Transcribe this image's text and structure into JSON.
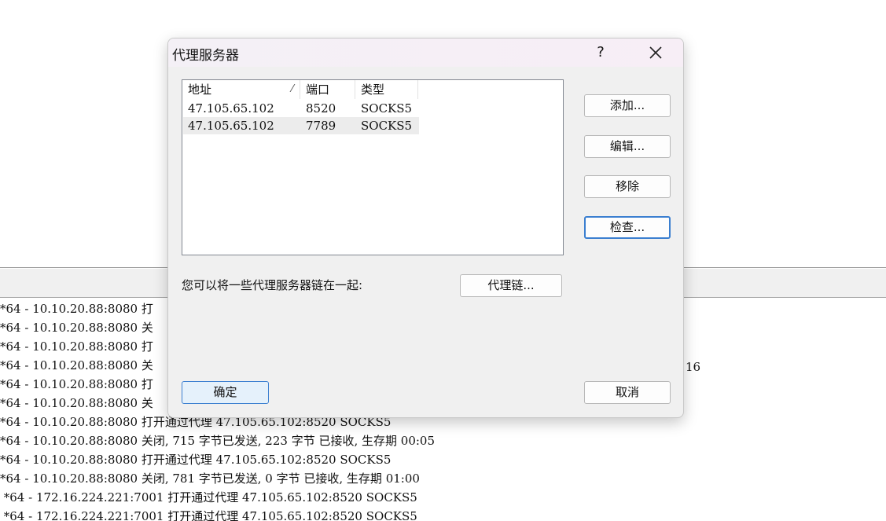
{
  "dialog": {
    "title": "代理服务器",
    "help_label": "?",
    "columns": [
      {
        "label": "地址",
        "sort_indicator": "⁄"
      },
      {
        "label": "端口"
      },
      {
        "label": "类型"
      }
    ],
    "rows": [
      {
        "address": "47.105.65.102",
        "port": "8520",
        "type": "SOCKS5",
        "selected": false
      },
      {
        "address": "47.105.65.102",
        "port": "7789",
        "type": "SOCKS5",
        "selected": true
      }
    ],
    "buttons": {
      "add": "添加...",
      "edit": "编辑...",
      "remove": "移除",
      "check": "检查...",
      "ok": "确定",
      "cancel": "取消",
      "chain": "代理链..."
    },
    "chain_text": "您可以将一些代理服务器链在一起:"
  },
  "log_lines": [
    "*64 - 10.10.20.88:8080 打",
    "*64 - 10.10.20.88:8080 关",
    "*64 - 10.10.20.88:8080 打",
    "*64 - 10.10.20.88:8080 关",
    "*64 - 10.10.20.88:8080 打",
    "*64 - 10.10.20.88:8080 关",
    "*64 - 10.10.20.88:8080 打开通过代理 47.105.65.102:8520 SOCKS5",
    "*64 - 10.10.20.88:8080 关闭, 715 字节已发送, 223 字节 已接收, 生存期 00:05",
    "*64 - 10.10.20.88:8080 打开通过代理 47.105.65.102:8520 SOCKS5",
    "*64 - 10.10.20.88:8080 关闭, 781 字节已发送, 0 字节 已接收, 生存期 01:00",
    " *64 - 172.16.224.221:7001 打开通过代理 47.105.65.102:8520 SOCKS5",
    " *64 - 172.16.224.221:7001 打开通过代理 47.105.65.102:8520 SOCKS5"
  ],
  "log_fragment": "16"
}
